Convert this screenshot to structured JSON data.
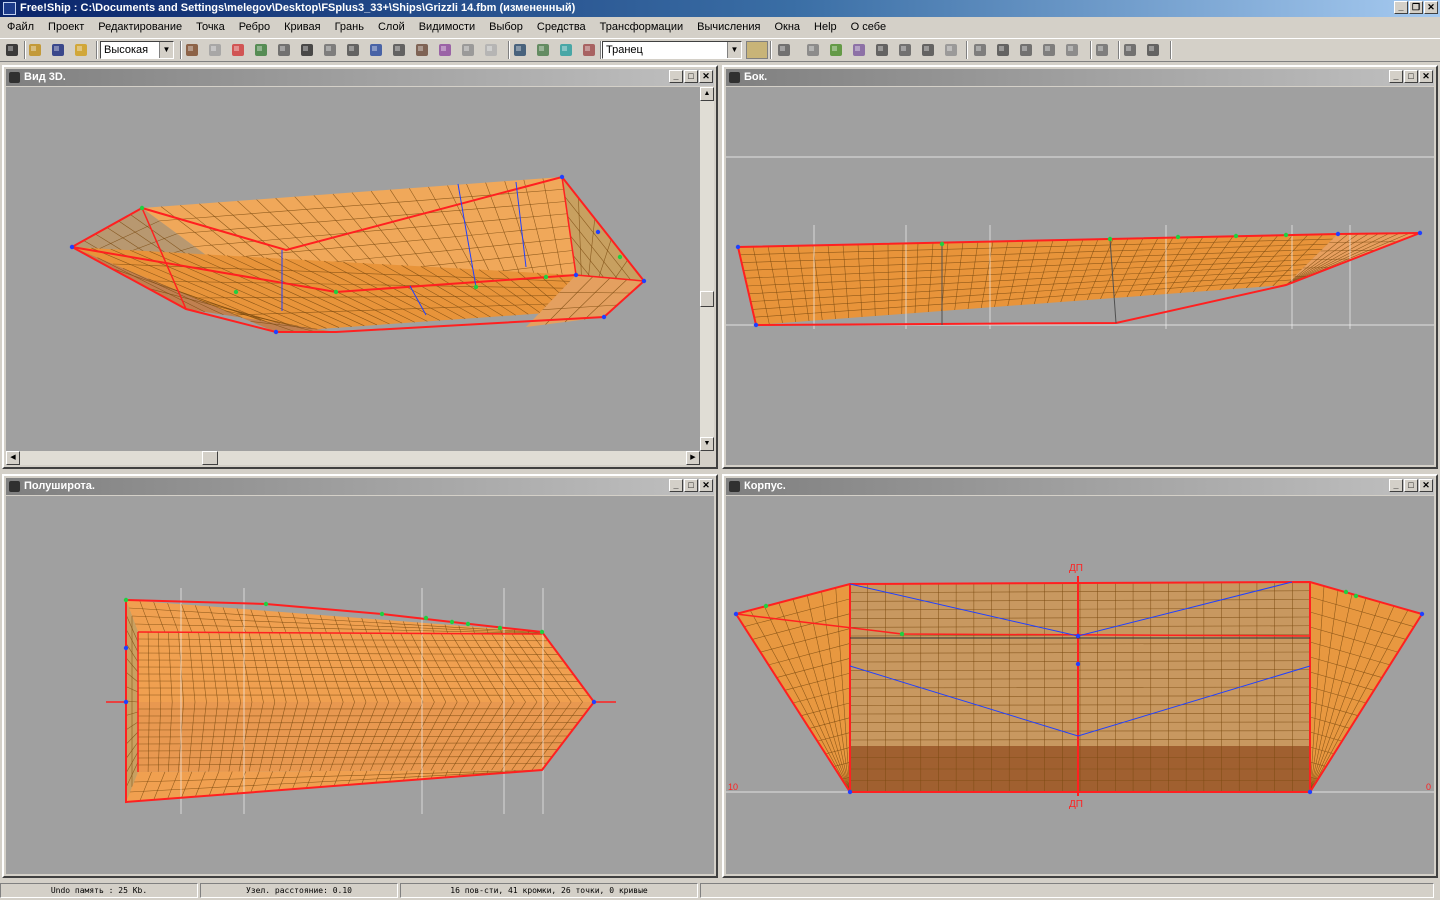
{
  "window": {
    "title": "Free!Ship : C:\\Documents and Settings\\melegov\\Desktop\\FSplus3_33+\\Ships\\Grizzli 14.fbm (измененный)"
  },
  "menu": [
    "Файл",
    "Проект",
    "Редактирование",
    "Точка",
    "Ребро",
    "Кривая",
    "Грань",
    "Слой",
    "Видимости",
    "Выбор",
    "Средства",
    "Трансформации",
    "Вычисления",
    "Окна",
    "Help",
    "О себе"
  ],
  "toolbar": {
    "precision_value": "Высокая",
    "layer_value": "Транец",
    "icons": [
      "new-file-icon",
      "open-folder-icon",
      "save-icon",
      "export-icon",
      "grid-icon",
      "curve-icon",
      "plane-icon",
      "sphere-icon",
      "mesh-icon",
      "globe-icon",
      "box-icon",
      "shade-icon",
      "render-icon",
      "stations-icon",
      "buttocks-icon",
      "waterlines-icon",
      "diagonals-icon",
      "curvature-icon",
      "flowline-icon",
      "filter-icon",
      "layer-color-icon",
      "select-icon",
      "move-icon",
      "mirror-icon",
      "extrude-icon",
      "rotate-icon",
      "lock-icon",
      "unlock-icon",
      "unlock-all-icon",
      "insert-point-icon",
      "split-edge-icon",
      "collapse-icon",
      "flatten-icon",
      "crease-icon",
      "curve-add-icon",
      "sparkle-icon",
      "gears-icon",
      "tools-icon"
    ]
  },
  "panels": {
    "view3d": {
      "title": "Вид 3D."
    },
    "side": {
      "title": "Бок."
    },
    "plan": {
      "title": "Полуширота."
    },
    "body": {
      "title": "Корпус.",
      "label_dp": "ДП",
      "label_left": "10",
      "label_right": "0"
    }
  },
  "status": {
    "undo": "Undo память : 25 Kb.",
    "node_distance": "Узел. расстояние: 0.10",
    "model_info": "16 пов-сти, 41 кромки, 26 точки, 0 кривые"
  },
  "colors": {
    "hull_fill": "#e8943a",
    "hull_edge": "#ff2020",
    "grid_line": "#7a4a10",
    "control_green": "#20d040",
    "control_blue": "#2040ff",
    "viewport_bg": "#a0a0a0"
  }
}
